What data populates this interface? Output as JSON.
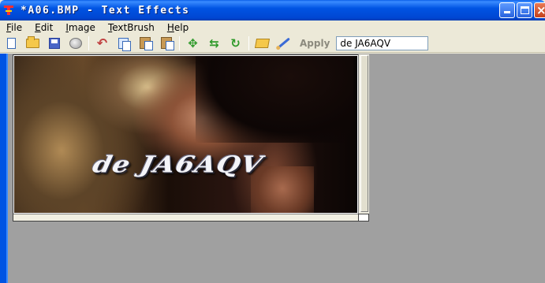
{
  "window": {
    "title": "*A06.BMP - Text Effects"
  },
  "menu": {
    "items": [
      {
        "first": "F",
        "rest": "ile"
      },
      {
        "first": "E",
        "rest": "dit"
      },
      {
        "first": "I",
        "rest": "mage"
      },
      {
        "first": "T",
        "rest": "extBrush"
      },
      {
        "first": "H",
        "rest": "elp"
      }
    ]
  },
  "toolbar": {
    "apply_label": "Apply",
    "text_value": "de  JA6AQV"
  },
  "canvas": {
    "overlay_text": "de JA6AQV"
  }
}
